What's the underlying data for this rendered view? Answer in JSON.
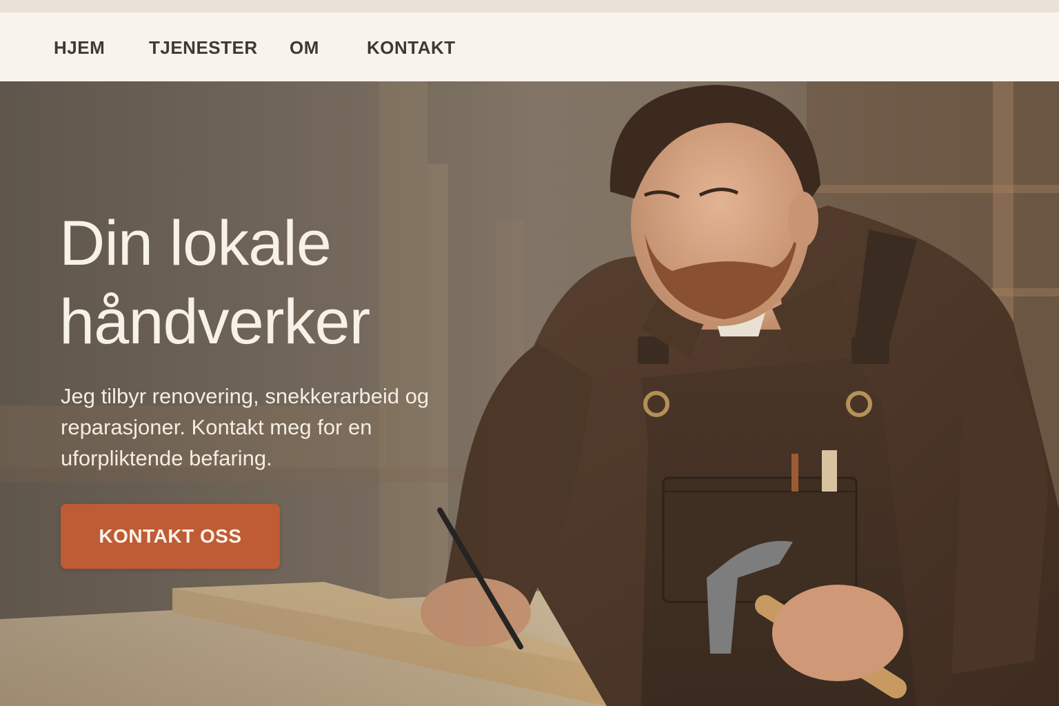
{
  "nav": {
    "items": [
      {
        "label": "HJEM"
      },
      {
        "label": "TJENESTER"
      },
      {
        "label": "OM"
      },
      {
        "label": "KONTAKT"
      }
    ]
  },
  "hero": {
    "headline_line1": "Din lokale",
    "headline_line2": "håndverker",
    "subtext_line1": "Jeg tilbyr renovering, snekkerarbeid og",
    "subtext_line2": "reparasjoner. Kontakt meg for en",
    "subtext_line3": "uforpliktende befaring.",
    "cta_label": "KONTAKT OSS",
    "image": "carpenter-at-workbench-photo"
  },
  "colors": {
    "nav_background": "#f8f3ec",
    "nav_text": "#3d3a35",
    "headline_text": "#f7f1e8",
    "cta_background": "#bf5b35",
    "cta_text": "#fbf2e8"
  }
}
